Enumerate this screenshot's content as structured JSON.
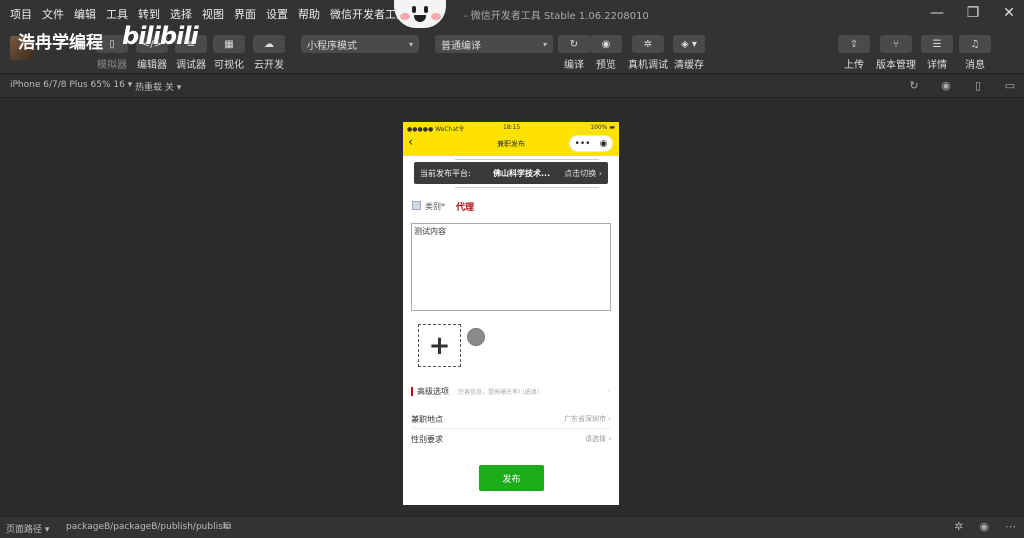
{
  "menu": [
    "项目",
    "文件",
    "编辑",
    "工具",
    "转到",
    "选择",
    "视图",
    "界面",
    "设置",
    "帮助",
    "微信开发者工具"
  ],
  "window_title": "- 微信开发者工具 Stable 1.06.2208010",
  "watermark": {
    "text": "浩冉学编程",
    "logo": "bilibili"
  },
  "toolbar": {
    "left_buttons": [
      {
        "label": "模拟器",
        "icon": "phone-icon"
      },
      {
        "label": "编辑器",
        "icon": "code-icon"
      },
      {
        "label": "调试器",
        "icon": "debug-icon"
      },
      {
        "label": "可视化",
        "icon": "layout-icon"
      },
      {
        "label": "云开发",
        "icon": "cloud-icon"
      }
    ],
    "mode_select": "小程序模式",
    "compile_select": "普通编译",
    "mid_buttons": [
      {
        "label": "编译",
        "icon": "refresh-icon"
      },
      {
        "label": "预览",
        "icon": "eye-icon"
      },
      {
        "label": "真机调试",
        "icon": "bug-icon"
      },
      {
        "label": "清缓存",
        "icon": "layers-icon"
      }
    ],
    "right_buttons": [
      {
        "label": "上传",
        "icon": "upload-icon"
      },
      {
        "label": "版本管理",
        "icon": "branch-icon"
      },
      {
        "label": "详情",
        "icon": "menu-icon"
      },
      {
        "label": "消息",
        "icon": "bell-icon"
      }
    ]
  },
  "device_bar": {
    "device": "iPhone 6/7/8 Plus 65% 16 ▾",
    "hot_reload": "热重载 关 ▾"
  },
  "phone": {
    "status": {
      "carrier": "●●●●● WeChat令",
      "time": "18:15",
      "battery": "100% ▬"
    },
    "nav_title": "兼职发布",
    "platform": {
      "label": "当前发布平台:",
      "name": "佛山科学技术...",
      "switch": "点击切换 ›"
    },
    "category": {
      "label": "类别*",
      "value": "代理"
    },
    "content": "测试内容",
    "upload_plus": "+",
    "advanced": {
      "label": "高级选项",
      "hint": "完善信息，提高曝光率! (选填)",
      "arrow": "›"
    },
    "rows": [
      {
        "label": "兼职地点",
        "value": "广东省深圳市 ›"
      },
      {
        "label": "性别要求",
        "value": "请选择 ›"
      }
    ],
    "publish_button": "发布"
  },
  "bottom_bar": {
    "page_path_label": "页面路径 ▾",
    "path": "packageB/packageB/publish/publish"
  }
}
